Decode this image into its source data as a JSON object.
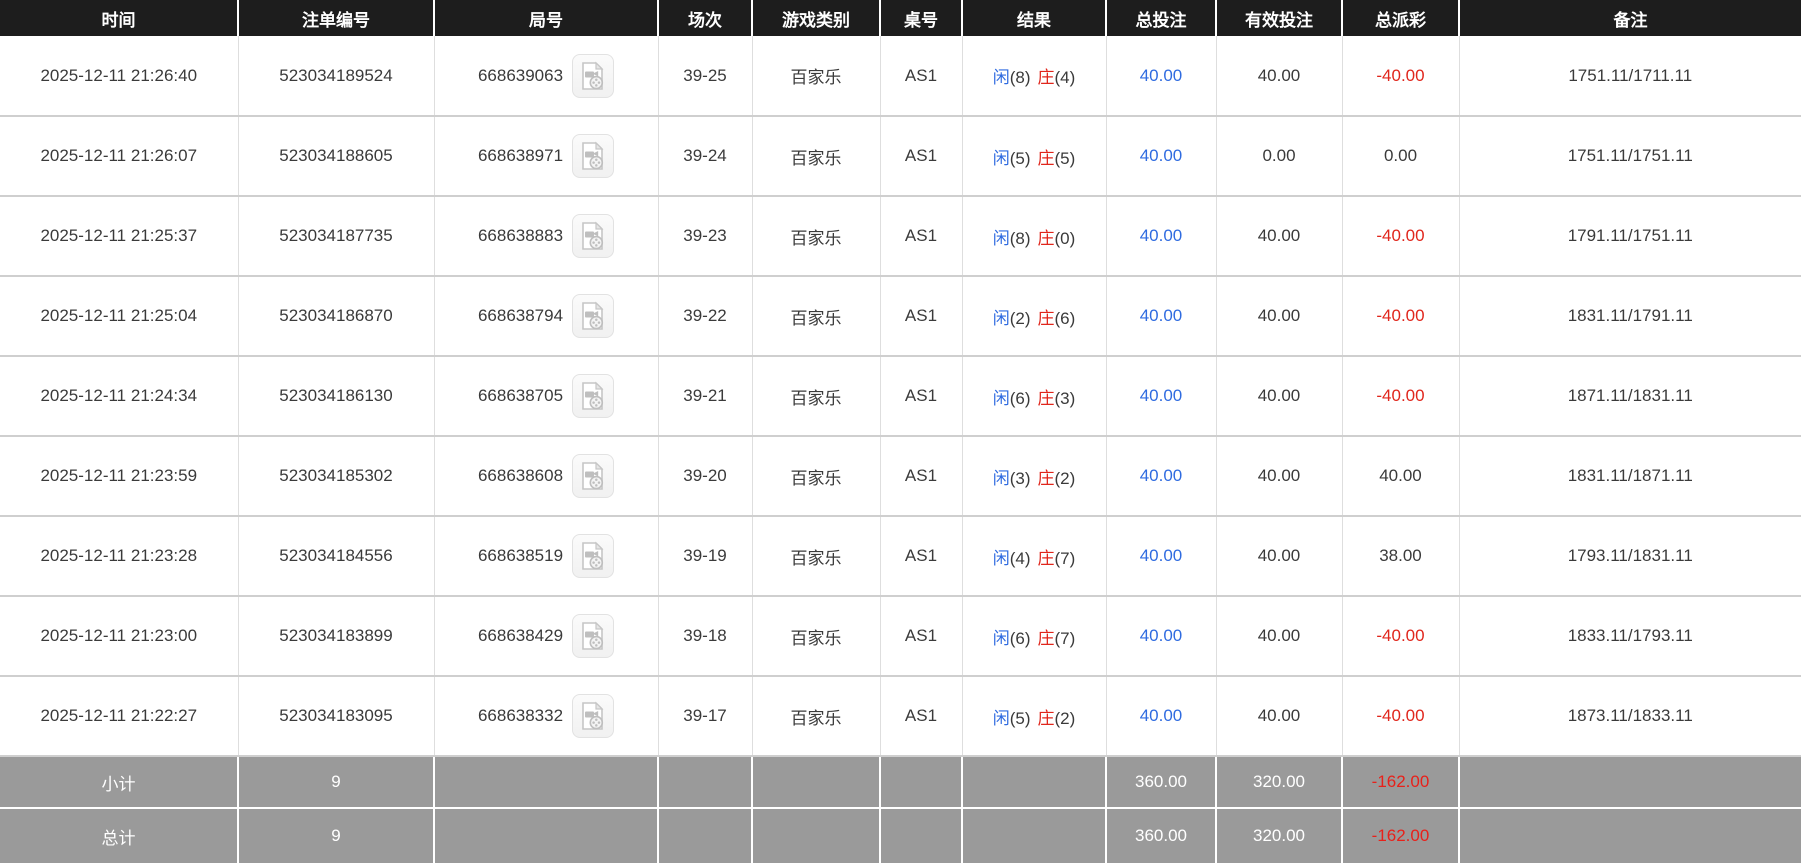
{
  "colors": {
    "header_bg": "#1d1d1d",
    "header_text": "#ffffff",
    "player_blue": "#2f6be0",
    "banker_red": "#e0261c",
    "amount_blue": "#2f6be0",
    "negative_red": "#e0261c",
    "summary_bg": "#9a9a9a",
    "summary_text": "#ffffff"
  },
  "table": {
    "columns": [
      {
        "label": "时间"
      },
      {
        "label": "注单编号"
      },
      {
        "label": "局号"
      },
      {
        "label": "场次"
      },
      {
        "label": "游戏类别"
      },
      {
        "label": "桌号"
      },
      {
        "label": "结果"
      },
      {
        "label": "总投注"
      },
      {
        "label": "有效投注"
      },
      {
        "label": "总派彩"
      },
      {
        "label": "备注"
      }
    ],
    "icons": {
      "video_replay": "video-file-icon"
    },
    "rows": [
      {
        "time": "2025-12-11 21:26:40",
        "bet_id": "523034189524",
        "round_id": "668639063",
        "session": "39-25",
        "game_type": "百家乐",
        "table_no": "AS1",
        "result": {
          "player": "闲",
          "player_count": "(8)",
          "banker": "庄",
          "banker_count": "(4)"
        },
        "total_bet": "40.00",
        "valid_bet": "40.00",
        "payout": "-40.00",
        "remark": "1751.11/1711.11"
      },
      {
        "time": "2025-12-11 21:26:07",
        "bet_id": "523034188605",
        "round_id": "668638971",
        "session": "39-24",
        "game_type": "百家乐",
        "table_no": "AS1",
        "result": {
          "player": "闲",
          "player_count": "(5)",
          "banker": "庄",
          "banker_count": "(5)"
        },
        "total_bet": "40.00",
        "valid_bet": "0.00",
        "payout": "0.00",
        "remark": "1751.11/1751.11"
      },
      {
        "time": "2025-12-11 21:25:37",
        "bet_id": "523034187735",
        "round_id": "668638883",
        "session": "39-23",
        "game_type": "百家乐",
        "table_no": "AS1",
        "result": {
          "player": "闲",
          "player_count": "(8)",
          "banker": "庄",
          "banker_count": "(0)"
        },
        "total_bet": "40.00",
        "valid_bet": "40.00",
        "payout": "-40.00",
        "remark": "1791.11/1751.11"
      },
      {
        "time": "2025-12-11 21:25:04",
        "bet_id": "523034186870",
        "round_id": "668638794",
        "session": "39-22",
        "game_type": "百家乐",
        "table_no": "AS1",
        "result": {
          "player": "闲",
          "player_count": "(2)",
          "banker": "庄",
          "banker_count": "(6)"
        },
        "total_bet": "40.00",
        "valid_bet": "40.00",
        "payout": "-40.00",
        "remark": "1831.11/1791.11"
      },
      {
        "time": "2025-12-11 21:24:34",
        "bet_id": "523034186130",
        "round_id": "668638705",
        "session": "39-21",
        "game_type": "百家乐",
        "table_no": "AS1",
        "result": {
          "player": "闲",
          "player_count": "(6)",
          "banker": "庄",
          "banker_count": "(3)"
        },
        "total_bet": "40.00",
        "valid_bet": "40.00",
        "payout": "-40.00",
        "remark": "1871.11/1831.11"
      },
      {
        "time": "2025-12-11 21:23:59",
        "bet_id": "523034185302",
        "round_id": "668638608",
        "session": "39-20",
        "game_type": "百家乐",
        "table_no": "AS1",
        "result": {
          "player": "闲",
          "player_count": "(3)",
          "banker": "庄",
          "banker_count": "(2)"
        },
        "total_bet": "40.00",
        "valid_bet": "40.00",
        "payout": "40.00",
        "remark": "1831.11/1871.11"
      },
      {
        "time": "2025-12-11 21:23:28",
        "bet_id": "523034184556",
        "round_id": "668638519",
        "session": "39-19",
        "game_type": "百家乐",
        "table_no": "AS1",
        "result": {
          "player": "闲",
          "player_count": "(4)",
          "banker": "庄",
          "banker_count": "(7)"
        },
        "total_bet": "40.00",
        "valid_bet": "40.00",
        "payout": "38.00",
        "remark": "1793.11/1831.11"
      },
      {
        "time": "2025-12-11 21:23:00",
        "bet_id": "523034183899",
        "round_id": "668638429",
        "session": "39-18",
        "game_type": "百家乐",
        "table_no": "AS1",
        "result": {
          "player": "闲",
          "player_count": "(6)",
          "banker": "庄",
          "banker_count": "(7)"
        },
        "total_bet": "40.00",
        "valid_bet": "40.00",
        "payout": "-40.00",
        "remark": "1833.11/1793.11"
      },
      {
        "time": "2025-12-11 21:22:27",
        "bet_id": "523034183095",
        "round_id": "668638332",
        "session": "39-17",
        "game_type": "百家乐",
        "table_no": "AS1",
        "result": {
          "player": "闲",
          "player_count": "(5)",
          "banker": "庄",
          "banker_count": "(2)"
        },
        "total_bet": "40.00",
        "valid_bet": "40.00",
        "payout": "-40.00",
        "remark": "1873.11/1833.11"
      }
    ],
    "subtotal": {
      "label": "小计",
      "count": "9",
      "total_bet": "360.00",
      "valid_bet": "320.00",
      "payout": "-162.00"
    },
    "total": {
      "label": "总计",
      "count": "9",
      "total_bet": "360.00",
      "valid_bet": "320.00",
      "payout": "-162.00"
    }
  }
}
